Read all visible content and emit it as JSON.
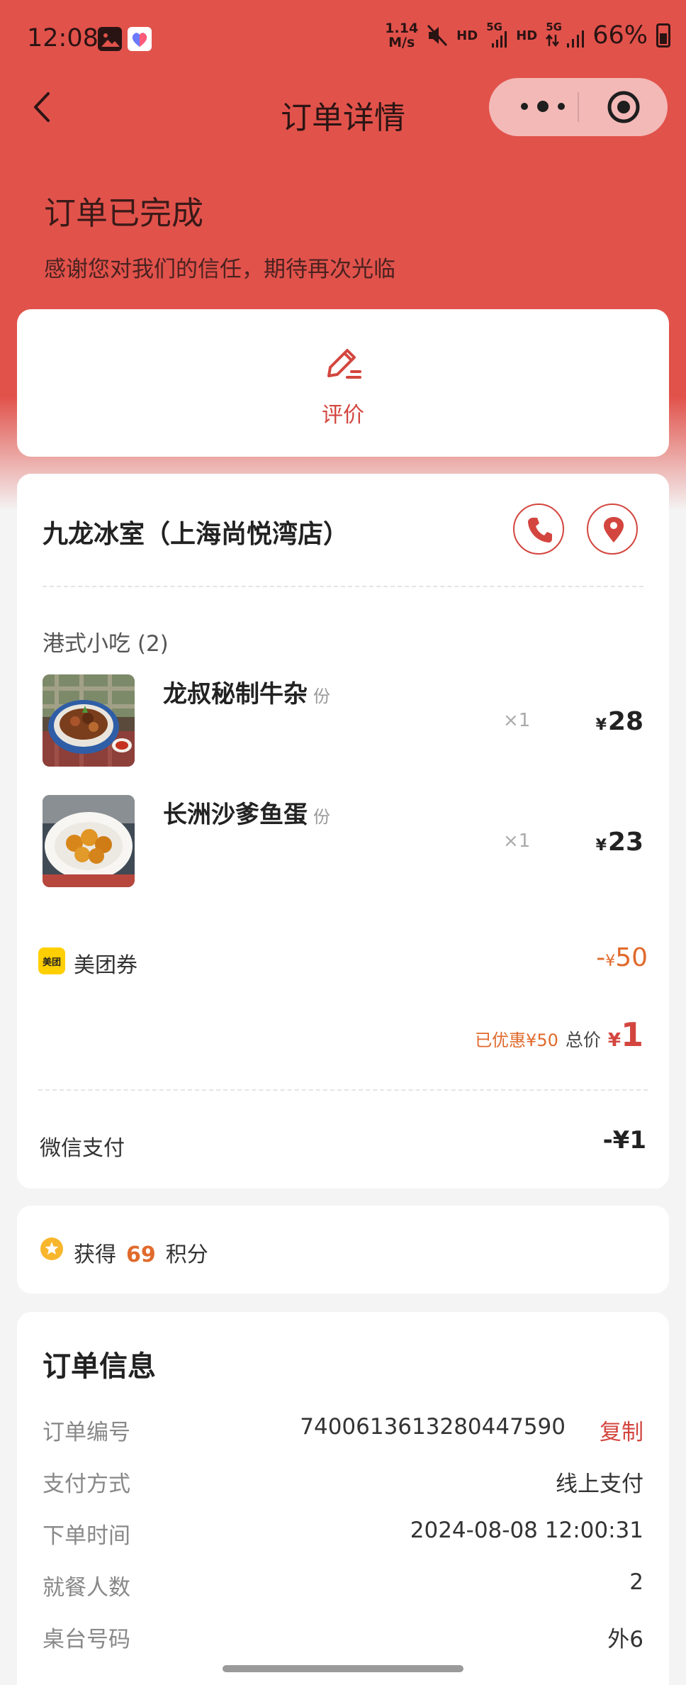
{
  "status_bar": {
    "time": "12:08",
    "net_speed_top": "1.14",
    "net_speed_bottom": "M/s",
    "hd1": "HD",
    "g1": "5G",
    "hd2": "HD",
    "g2": "5G",
    "battery": "66%"
  },
  "nav": {
    "title": "订单详情"
  },
  "order_status": {
    "title": "订单已完成",
    "subtitle": "感谢您对我们的信任，期待再次光临"
  },
  "review": {
    "label": "评价"
  },
  "shop": {
    "name": "九龙冰室（上海尚悦湾店）"
  },
  "category": {
    "label": "港式小吃 (2)"
  },
  "items": [
    {
      "name": "龙叔秘制牛杂",
      "unit": "份",
      "qty": "×1",
      "currency": "¥",
      "price": "28"
    },
    {
      "name": "长洲沙爹鱼蛋",
      "unit": "份",
      "qty": "×1",
      "currency": "¥",
      "price": "23"
    }
  ],
  "coupon": {
    "badge": "美团",
    "label": "美团券",
    "amount_prefix": "-",
    "currency": "¥",
    "amount": "50"
  },
  "total": {
    "saved": "已优惠¥50",
    "label": "总价",
    "currency": "¥",
    "value": "1"
  },
  "payment": {
    "label": "微信支付",
    "value": "-¥1"
  },
  "points": {
    "prefix": "获得",
    "value": "69",
    "suffix": "积分"
  },
  "order_info": {
    "title": "订单信息",
    "copy_label": "复制",
    "rows": [
      {
        "key": "订单编号",
        "value": "7400613613280447590"
      },
      {
        "key": "支付方式",
        "value": "线上支付"
      },
      {
        "key": "下单时间",
        "value": "2024-08-08 12:00:31"
      },
      {
        "key": "就餐人数",
        "value": "2"
      },
      {
        "key": "桌台号码",
        "value": "外6"
      }
    ]
  },
  "colors": {
    "brand_red": "#e1524b",
    "accent_red": "#d3463f",
    "orange": "#e06a2c",
    "meituan_yellow": "#ffcf00"
  }
}
